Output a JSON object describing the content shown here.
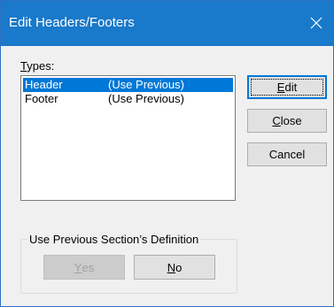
{
  "dialog": {
    "title": "Edit Headers/Footers",
    "close_icon": "close-icon",
    "accent_color": "#1979ca",
    "types_label_underlined": "T",
    "types_label_rest": "ypes:",
    "list": [
      {
        "name": "Header",
        "value": "(Use Previous)",
        "selected": true
      },
      {
        "name": "Footer",
        "value": "(Use Previous)",
        "selected": false
      }
    ],
    "buttons": {
      "edit": {
        "ul": "E",
        "rest": "dit"
      },
      "close": {
        "ul": "C",
        "rest": "lose"
      },
      "cancel": {
        "label": "Cancel"
      }
    },
    "group": {
      "label": "Use Previous Section’s Definition",
      "yes": {
        "ul": "Y",
        "rest": "es",
        "disabled": true
      },
      "no": {
        "ul": "N",
        "rest": "o"
      }
    }
  }
}
